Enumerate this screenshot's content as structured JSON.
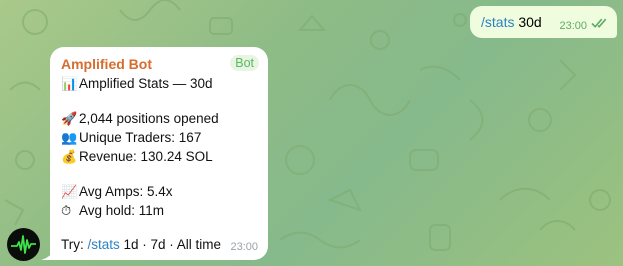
{
  "outgoing": {
    "command": "/stats",
    "argument": " 30d",
    "time": "23:00",
    "status_icon": "double-check-icon"
  },
  "incoming": {
    "sender": "Amplified Bot",
    "badge": "Bot",
    "time": "23:00",
    "title": "Amplified Stats — 30d",
    "positions": "2,044 positions opened",
    "traders": "Unique Traders: 167",
    "revenue": "Revenue: 130.24 SOL",
    "amps": "Avg Amps: 5.4x",
    "hold": "Avg hold: 11m",
    "try_label": "Try: ",
    "try_command": "/stats",
    "try_options": " 1d · 7d · All time",
    "icons": [
      "bar-chart-icon",
      "rocket-icon",
      "people-icon",
      "money-bag-icon",
      "trend-up-icon",
      "stopwatch-icon"
    ]
  },
  "colors": {
    "sender": "#d66c2e",
    "link": "#2c82c4",
    "badge": "#5bb85f",
    "outgoing_bubble": "#effdde",
    "avatar_pulse": "#3ee24a"
  }
}
